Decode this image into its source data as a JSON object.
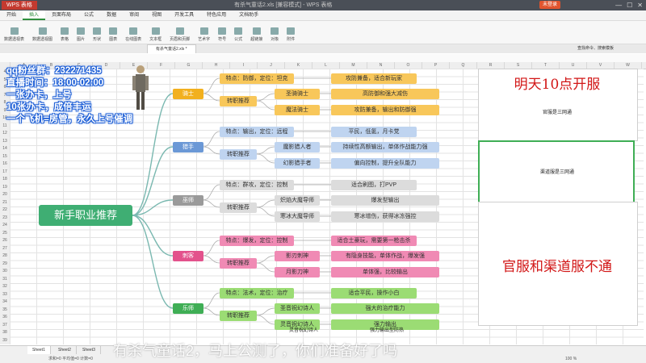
{
  "app": {
    "name": "WPS 表格",
    "window_title": "有杀气童话2.xls [兼容模式] - WPS 表格",
    "login": "未登录"
  },
  "menu": [
    "开始",
    "插入",
    "页面布局",
    "公式",
    "数据",
    "审阅",
    "视图",
    "开发工具",
    "特色应用",
    "文档助手"
  ],
  "ribbon": [
    "数据透视表",
    "数据透视图",
    "表格",
    "图片",
    "形状",
    "图表",
    "在线图表",
    "文本框",
    "页眉和页脚",
    "艺术字",
    "符号",
    "公式",
    "超链接",
    "对象",
    "附件"
  ],
  "file_tab": "有杀气童话2.xls *",
  "search": "查找命令、搜索模板",
  "overlay": [
    "qq粉丝群：232271435",
    "直播时间：18:00-02:00",
    "一张办卡，上号",
    "10张办卡，成倍丰运",
    "一个飞机=房管，永久上号催调"
  ],
  "mindmap": {
    "root": "新手职业推荐",
    "branches": [
      {
        "name": "骑士",
        "color": "#f2b01e",
        "light": "#f8c75a",
        "trait": "特点：防御，定位：坦克",
        "trait_note": "攻防兼备，适合新玩家",
        "sub": "转职推荐",
        "jobs": [
          {
            "name": "圣骑骑士",
            "note": "高防御和强大减伤"
          },
          {
            "name": "魔法骑士",
            "note": "攻防兼备，输出和防御强"
          }
        ]
      },
      {
        "name": "猎手",
        "color": "#6b98d6",
        "light": "#bfd4f0",
        "trait": "特点：输出，定位：远程",
        "trait_note": "平民，低氪，月卡党",
        "sub": "转职推荐",
        "jobs": [
          {
            "name": "魔影猎人者",
            "note": "持续性高额输出，单体作战能力强"
          },
          {
            "name": "幻影猎手者",
            "note": "偏向控制，提升全队能力"
          }
        ]
      },
      {
        "name": "巫师",
        "color": "#9a9a9a",
        "light": "#dcdcdc",
        "trait": "特点：群攻，定位：控制",
        "trait_note": "适合刷图，打PVP",
        "sub": "转职推荐",
        "jobs": [
          {
            "name": "炽焰大魔导师",
            "note": "爆发型输出"
          },
          {
            "name": "寒冰大魔导师",
            "note": "寒冰增伤，获得冰冻强控"
          }
        ]
      },
      {
        "name": "刺客",
        "color": "#e3528c",
        "light": "#f08ab4",
        "trait": "特点：爆发，定位：控制",
        "trait_note": "适合土豪玩，需要第一枪击杀",
        "sub": "转职推荐",
        "jobs": [
          {
            "name": "影刃刺神",
            "note": "有隐身技能，单体作战，爆发强"
          },
          {
            "name": "月影刀神",
            "note": "单体强，比较输出"
          }
        ]
      },
      {
        "name": "乐师",
        "color": "#3fae55",
        "light": "#9bdc74",
        "trait": "特点：法术，定位：治疗",
        "trait_note": "适合平民，操作小白",
        "sub": "转职推荐",
        "jobs": [
          {
            "name": "圣音祝幻诗人",
            "note": "强大的治疗能力"
          },
          {
            "name": "灵音祝幻诗人",
            "note": "强力输出"
          }
        ]
      }
    ]
  },
  "right_panel": {
    "top": "明天10点开服",
    "top_small": "官服是三网通",
    "mid_small": "渠道服是三网通",
    "bottom": "官服和渠道服不通"
  },
  "low_cells": [
    "灵音祝幻诗人",
    "强力输出型防热"
  ],
  "sheets": [
    "Sheet1",
    "Sheet2",
    "Sheet3"
  ],
  "status": {
    "left": "求和=0  平均值=0  计数=0",
    "zoom": "100 %"
  },
  "subtitle": "有杀气童话2，马上公测了，你们准备好了吗"
}
